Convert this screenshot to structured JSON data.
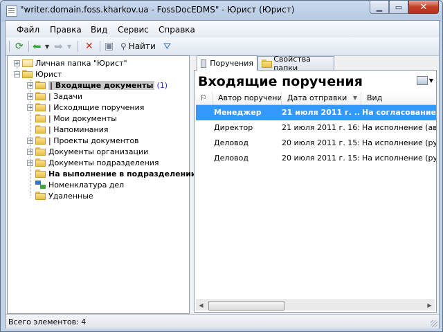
{
  "window": {
    "title": "\"writer.domain.foss.kharkov.ua - FossDocEDMS\" - Юрист (Юрист)"
  },
  "menu": [
    "Файл",
    "Правка",
    "Вид",
    "Сервис",
    "Справка"
  ],
  "toolbar": {
    "find_label": "Найти"
  },
  "tree": {
    "personal_folder": "Личная папка \"Юрист\"",
    "root": "Юрист",
    "items": [
      {
        "label": "| Входящие документы",
        "count": "(1)"
      },
      {
        "label": "| Задачи"
      },
      {
        "label": "| Исходящие поручения"
      },
      {
        "label": "| Мои документы"
      },
      {
        "label": "| Напоминания"
      },
      {
        "label": "| Проекты документов"
      },
      {
        "label": "Документы организации"
      },
      {
        "label": "Документы подразделения"
      },
      {
        "label": "На выполнение в подразделении"
      },
      {
        "label": "Номенклатура дел"
      },
      {
        "label": "Удаленные"
      }
    ]
  },
  "tabs": [
    "Поручения",
    "Свойства папки"
  ],
  "view": {
    "title": "Входящие поручения"
  },
  "table": {
    "columns": [
      "Автор поручения",
      "Дата отправки",
      "Вид"
    ],
    "rows": [
      [
        "Менеджер",
        "21 июля 2011 г. ...",
        "На согласование"
      ],
      [
        "Директор",
        "21 июля 2011 г. 16:...",
        "На исполнение (авто"
      ],
      [
        "Деловод",
        "20 июля 2011 г. 15:...",
        "На исполнение (ручн"
      ],
      [
        "Деловод",
        "20 июля 2011 г. 15:...",
        "На исполнение (ручн"
      ]
    ]
  },
  "status": {
    "text": "Всего элементов: 4"
  }
}
